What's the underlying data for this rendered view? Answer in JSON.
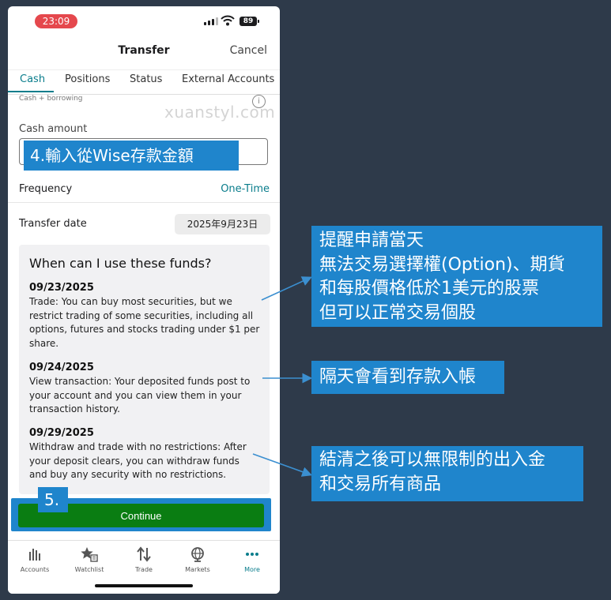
{
  "status_bar": {
    "time": "23:09",
    "battery": "89"
  },
  "nav": {
    "title": "Transfer",
    "cancel": "Cancel"
  },
  "tabs": [
    {
      "label": "Cash",
      "active": true
    },
    {
      "label": "Positions",
      "active": false
    },
    {
      "label": "Status",
      "active": false
    },
    {
      "label": "External Accounts",
      "active": false
    }
  ],
  "form": {
    "cutoff_label": "Cash + borrowing",
    "info_icon": "i",
    "watermark": "xuanstyl.com",
    "cash_amount_label": "Cash amount",
    "frequency_label": "Frequency",
    "frequency_value": "One-Time",
    "transfer_date_label": "Transfer date",
    "transfer_date_value": "2025年9月23日"
  },
  "funds": {
    "title": "When can I use these funds?",
    "entries": [
      {
        "date": "09/23/2025",
        "text": "Trade: You can buy most securities, but we restrict trading of some securities, including all options, futures and stocks trading under $1 per share."
      },
      {
        "date": "09/24/2025",
        "text": "View transaction: Your deposited funds post to your account and you can view them in your transaction history."
      },
      {
        "date": "09/29/2025",
        "text": "Withdraw and trade with no restrictions: After your deposit clears, you can withdraw funds and buy any security with no restrictions."
      }
    ]
  },
  "continue_label": "Continue",
  "tabbar": [
    {
      "label": "Accounts",
      "icon": "bar-chart-icon"
    },
    {
      "label": "Watchlist",
      "icon": "star-list-icon"
    },
    {
      "label": "Trade",
      "icon": "up-down-arrows-icon"
    },
    {
      "label": "Markets",
      "icon": "globe-icon"
    },
    {
      "label": "More",
      "icon": "more-dots-icon",
      "active": true
    }
  ],
  "annotations": {
    "step4": "4.輸入從Wise存款金額",
    "step5": "5.",
    "callout1": [
      "提醒申請當天",
      "無法交易選擇權(Option)、期貨",
      "和每股價格低於1美元的股票",
      "但可以正常交易個股"
    ],
    "callout2": "隔天會看到存款入帳",
    "callout3": [
      "結清之後可以無限制的出入金",
      "和交易所有商品"
    ]
  },
  "colors": {
    "accent": "#0a7d8c",
    "continue_button": "#0a7d12",
    "annotation": "#1f85cc",
    "background": "#2e3a4a",
    "status_time": "#e5484d"
  }
}
